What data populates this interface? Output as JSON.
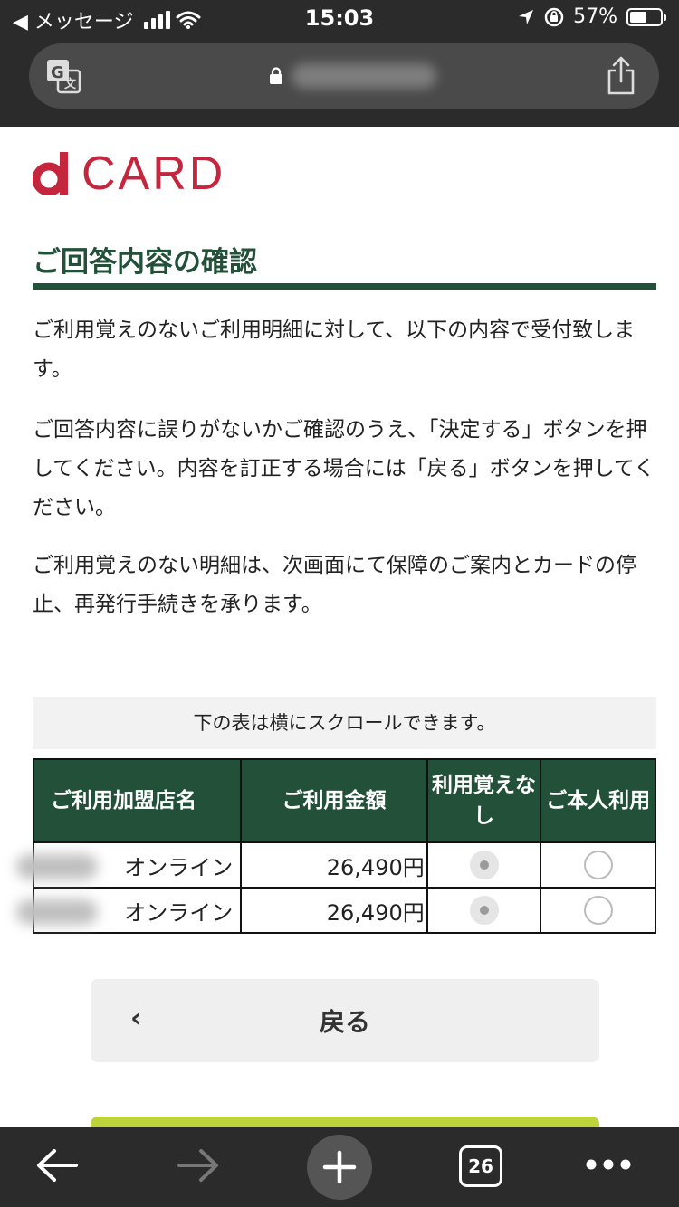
{
  "status_bar": {
    "back_app": "◀ メッセージ",
    "time": "15:03",
    "battery_percent": "57%",
    "battery_level": 0.57
  },
  "browser": {
    "url_hidden": true,
    "tab_count": "26"
  },
  "logo": {
    "text": "CARD"
  },
  "page": {
    "title": "ご回答内容の確認",
    "paragraphs": [
      "ご利用覚えのないご利用明細に対して、以下の内容で受付致します。",
      "ご回答内容に誤りがないかご確認のうえ、「決定する」ボタンを押してください。内容を訂正する場合には「戻る」ボタンを押してください。",
      "ご利用覚えのない明細は、次画面にて保障のご案内とカードの停止、再発行手続きを承ります。"
    ],
    "scroll_note": "下の表は横にスクロールできます。"
  },
  "table": {
    "headers": {
      "merchant": "ご利用加盟店名",
      "amount": "ご利用金額",
      "not_used": "利用覚えなし",
      "self_used": "ご本人利用"
    },
    "rows": [
      {
        "merchant": "オンライン",
        "amount": "26,490円",
        "not_used": true,
        "self_used": false
      },
      {
        "merchant": "オンライン",
        "amount": "26,490円",
        "not_used": true,
        "self_used": false
      }
    ]
  },
  "buttons": {
    "back_chevron": "‹",
    "back_label": "戻る"
  },
  "colors": {
    "brand_red": "#c4273d",
    "heading_green": "#225038",
    "accent_lime": "#bcd33c",
    "chrome_dark": "#2b2b2b"
  },
  "icons": [
    "translate-icon",
    "lock-icon",
    "share-icon",
    "wifi-icon",
    "location-arrow-icon",
    "orientation-lock-icon",
    "battery-icon",
    "back-arrow-icon",
    "forward-arrow-icon",
    "plus-icon",
    "more-icon"
  ]
}
